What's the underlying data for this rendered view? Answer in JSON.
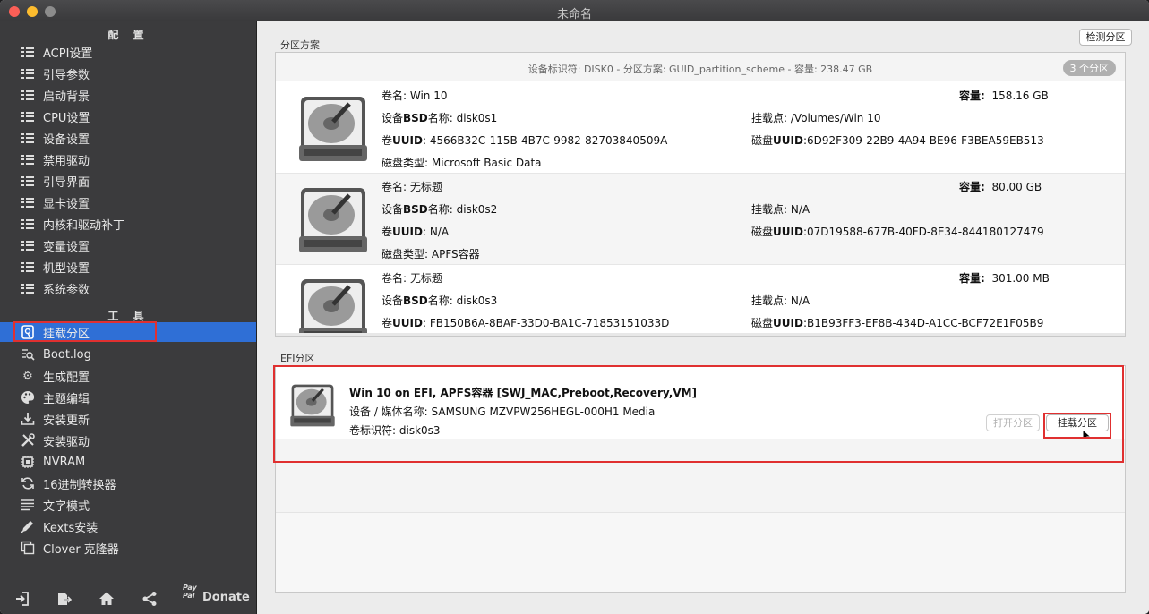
{
  "window": {
    "title": "未命名"
  },
  "sidebar": {
    "config_header": "配 置",
    "config_items": [
      {
        "label": "ACPI设置",
        "icon": "list-icon"
      },
      {
        "label": "引导参数",
        "icon": "list-icon"
      },
      {
        "label": "启动背景",
        "icon": "list-icon"
      },
      {
        "label": "CPU设置",
        "icon": "list-icon"
      },
      {
        "label": "设备设置",
        "icon": "list-icon"
      },
      {
        "label": "禁用驱动",
        "icon": "list-icon"
      },
      {
        "label": "引导界面",
        "icon": "list-icon"
      },
      {
        "label": "显卡设置",
        "icon": "list-icon"
      },
      {
        "label": "内核和驱动补丁",
        "icon": "list-icon"
      },
      {
        "label": "变量设置",
        "icon": "list-icon"
      },
      {
        "label": "机型设置",
        "icon": "list-icon"
      },
      {
        "label": "系统参数",
        "icon": "list-icon"
      }
    ],
    "tools_header": "工 具",
    "tool_items": [
      {
        "label": "挂载分区",
        "icon": "disk-icon",
        "selected": true
      },
      {
        "label": "Boot.log",
        "icon": "log-icon"
      },
      {
        "label": "生成配置",
        "icon": "gears-icon"
      },
      {
        "label": "主题编辑",
        "icon": "palette-icon"
      },
      {
        "label": "安装更新",
        "icon": "download-icon"
      },
      {
        "label": "安装驱动",
        "icon": "tools-icon"
      },
      {
        "label": "NVRAM",
        "icon": "chip-icon"
      },
      {
        "label": "16进制转换器",
        "icon": "refresh-icon"
      },
      {
        "label": "文字模式",
        "icon": "text-icon"
      },
      {
        "label": "Kexts安装",
        "icon": "pen-icon"
      },
      {
        "label": "Clover 克隆器",
        "icon": "copy-icon"
      }
    ],
    "bottom": {
      "donate_label": "Donate",
      "paypal_text": "Pay Pal"
    }
  },
  "main": {
    "detect_button": "检测分区",
    "partition_group_label": "分区方案",
    "disk_header": "设备标识符: DISK0 - 分区方案: GUID_partition_scheme - 容量: 238.47 GB",
    "partition_count_badge": "3 个分区",
    "partitions": [
      {
        "volume_name_label": "卷名:",
        "volume_name": "Win 10",
        "capacity_label": "容量:",
        "capacity": "158.16 GB",
        "bsd_label_pre": "设备",
        "bsd_label_b": "BSD",
        "bsd_label_post": "名称:",
        "bsd_name": "disk0s1",
        "mount_label": "挂载点:",
        "mount_point": "/Volumes/Win 10",
        "uuid_label_pre": "卷",
        "uuid_label_b": "UUID",
        "uuid_label_post": ":",
        "uuid": "4566B32C-115B-4B7C-9982-82703840509A",
        "disk_uuid_label_pre": "磁盘",
        "disk_uuid_label_b": "UUID",
        "disk_uuid_label_post": ":",
        "disk_uuid": "6D92F309-22B9-4A94-BE96-F3BEA59EB513",
        "type_label": "磁盘类型:",
        "type": "Microsoft Basic Data"
      },
      {
        "volume_name_label": "卷名:",
        "volume_name": "无标题",
        "capacity_label": "容量:",
        "capacity": "80.00 GB",
        "bsd_label_pre": "设备",
        "bsd_label_b": "BSD",
        "bsd_label_post": "名称:",
        "bsd_name": "disk0s2",
        "mount_label": "挂载点:",
        "mount_point": "N/A",
        "uuid_label_pre": "卷",
        "uuid_label_b": "UUID",
        "uuid_label_post": ":",
        "uuid": "N/A",
        "disk_uuid_label_pre": "磁盘",
        "disk_uuid_label_b": "UUID",
        "disk_uuid_label_post": ":",
        "disk_uuid": "07D19588-677B-40FD-8E34-844180127479",
        "type_label": "磁盘类型:",
        "type": "APFS容器"
      },
      {
        "volume_name_label": "卷名:",
        "volume_name": "无标题",
        "capacity_label": "容量:",
        "capacity": "301.00 MB",
        "bsd_label_pre": "设备",
        "bsd_label_b": "BSD",
        "bsd_label_post": "名称:",
        "bsd_name": "disk0s3",
        "mount_label": "挂载点:",
        "mount_point": "N/A",
        "uuid_label_pre": "卷",
        "uuid_label_b": "UUID",
        "uuid_label_post": ":",
        "uuid": "FB150B6A-8BAF-33D0-BA1C-71853151033D",
        "disk_uuid_label_pre": "磁盘",
        "disk_uuid_label_b": "UUID",
        "disk_uuid_label_post": ":",
        "disk_uuid": "B1B93FF3-EF8B-434D-A1CC-BCF72E1F05B9",
        "type_label": "",
        "type": ""
      }
    ],
    "efi_group_label": "EFI分区",
    "efi": {
      "title": "Win 10 on EFI, APFS容器 [SWJ_MAC,Preboot,Recovery,VM]",
      "media_label": "设备 / 媒体名称:",
      "media": "SAMSUNG MZVPW256HEGL-000H1 Media",
      "id_label": "卷标识符:",
      "id": "disk0s3",
      "open_button": "打开分区",
      "mount_button": "挂载分区"
    }
  },
  "colors": {
    "selected": "#2f6fd6",
    "highlight_box": "#e03030",
    "sidebar_bg": "#3b3b3d"
  }
}
